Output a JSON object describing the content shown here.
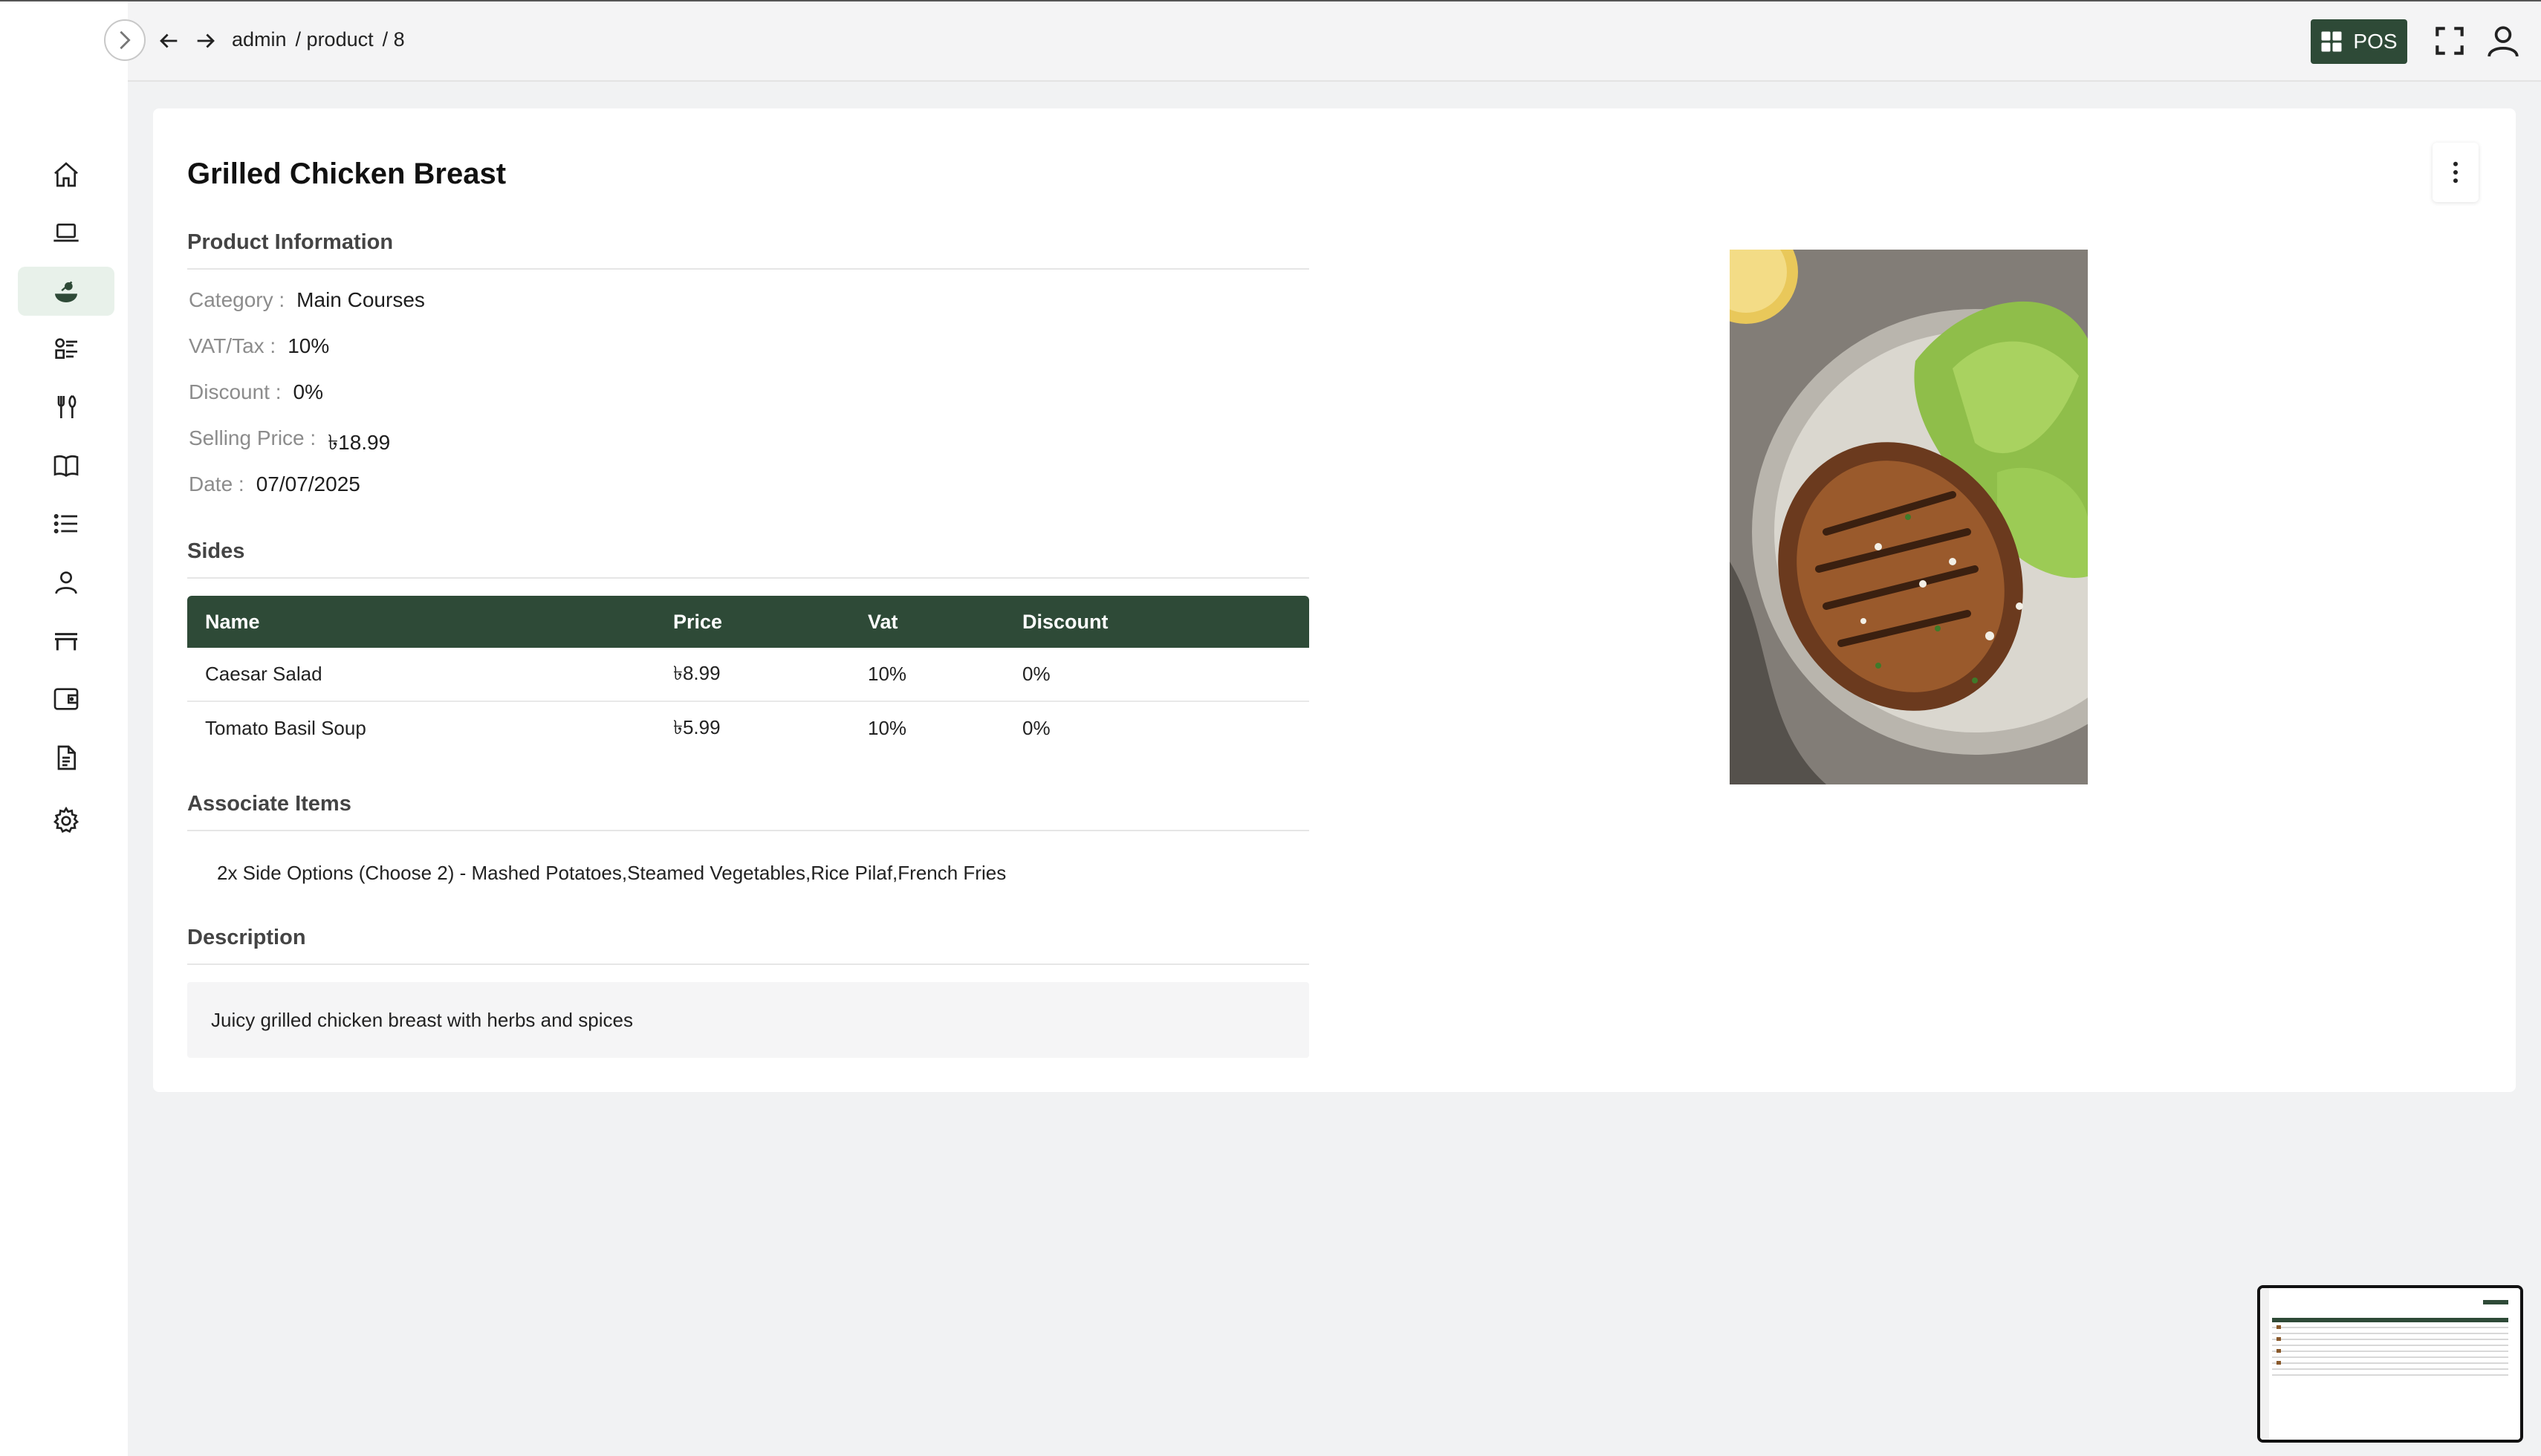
{
  "breadcrumb": {
    "segments": [
      "admin",
      "/ product",
      "/ 8"
    ]
  },
  "topbar": {
    "pos_label": "POS"
  },
  "sidebar": {
    "icons": [
      "home-icon",
      "laptop-icon",
      "dish-icon",
      "items-icon",
      "utensils-icon",
      "book-icon",
      "list-icon",
      "user-icon",
      "table-icon",
      "wallet-icon",
      "report-icon",
      "gear-icon"
    ],
    "active_index": 2
  },
  "product": {
    "title": "Grilled Chicken Breast",
    "sections": {
      "info": "Product Information",
      "sides": "Sides",
      "associate": "Associate Items",
      "description": "Description"
    },
    "info": {
      "category_label": "Category :",
      "category": "Main Courses",
      "vat_label": "VAT/Tax :",
      "vat": "10%",
      "discount_label": "Discount :",
      "discount": "0%",
      "price_label": "Selling Price :",
      "price": "৳18.99",
      "date_label": "Date :",
      "date": "07/07/2025"
    },
    "sides_table": {
      "headers": [
        "Name",
        "Price",
        "Vat",
        "Discount"
      ],
      "rows": [
        [
          "Caesar Salad",
          "৳8.99",
          "10%",
          "0%"
        ],
        [
          "Tomato Basil Soup",
          "৳5.99",
          "10%",
          "0%"
        ]
      ]
    },
    "associate_items": "2x Side Options (Choose 2) - Mashed Potatoes,Steamed Vegetables,Rice Pilaf,French Fries",
    "description": "Juicy grilled chicken breast with herbs and spices"
  },
  "colors": {
    "accent": "#2e4a37",
    "active_bg": "#e8f1ea",
    "page_bg": "#f1f2f3"
  }
}
